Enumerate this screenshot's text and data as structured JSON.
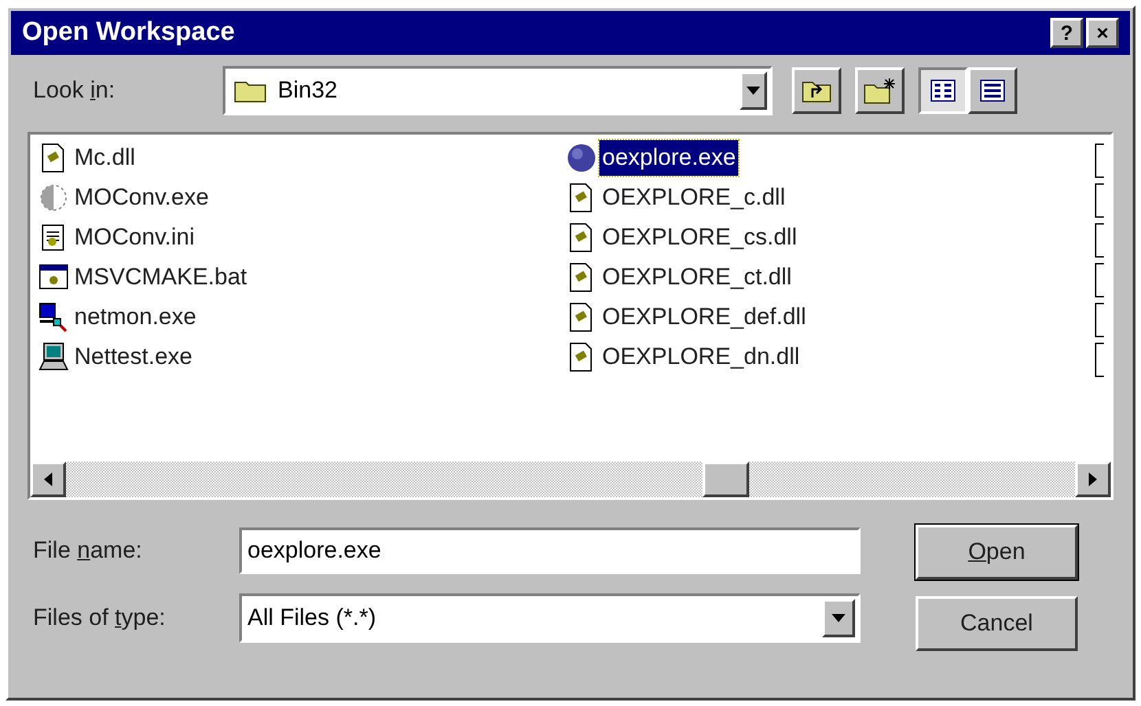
{
  "window": {
    "title": "Open Workspace",
    "controls": [
      "?",
      "×"
    ]
  },
  "look_in": {
    "label": {
      "before": "Look ",
      "key": "i",
      "after": "n:"
    },
    "value": "Bin32"
  },
  "files": {
    "columns": [
      [
        {
          "name": "Mc.dll",
          "kind": "dll",
          "selected": false
        },
        {
          "name": "MOConv.exe",
          "kind": "globe",
          "selected": false
        },
        {
          "name": "MOConv.ini",
          "kind": "ini",
          "selected": false
        },
        {
          "name": "MSVCMAKE.bat",
          "kind": "bat",
          "selected": false
        },
        {
          "name": "netmon.exe",
          "kind": "netmon",
          "selected": false
        },
        {
          "name": "Nettest.exe",
          "kind": "computer",
          "selected": false
        }
      ],
      [
        {
          "name": "oexplore.exe",
          "kind": "sphere",
          "selected": true
        },
        {
          "name": "OEXPLORE_c.dll",
          "kind": "dll",
          "selected": false
        },
        {
          "name": "OEXPLORE_cs.dll",
          "kind": "dll",
          "selected": false
        },
        {
          "name": "OEXPLORE_ct.dll",
          "kind": "dll",
          "selected": false
        },
        {
          "name": "OEXPLORE_def.dll",
          "kind": "dll",
          "selected": false
        },
        {
          "name": "OEXPLORE_dn.dll",
          "kind": "dll",
          "selected": false
        }
      ]
    ]
  },
  "file_name": {
    "label": {
      "before": "File ",
      "key": "n",
      "after": "ame:"
    },
    "value": "oexplore.exe"
  },
  "files_of_type": {
    "label": {
      "before": "Files of ",
      "key": "t",
      "after": "ype:"
    },
    "value": "All Files (*.*)"
  },
  "buttons": [
    {
      "label": {
        "key": "O",
        "after": "pen"
      },
      "default": true
    },
    {
      "label": {
        "before": "Cancel"
      },
      "default": false
    }
  ]
}
